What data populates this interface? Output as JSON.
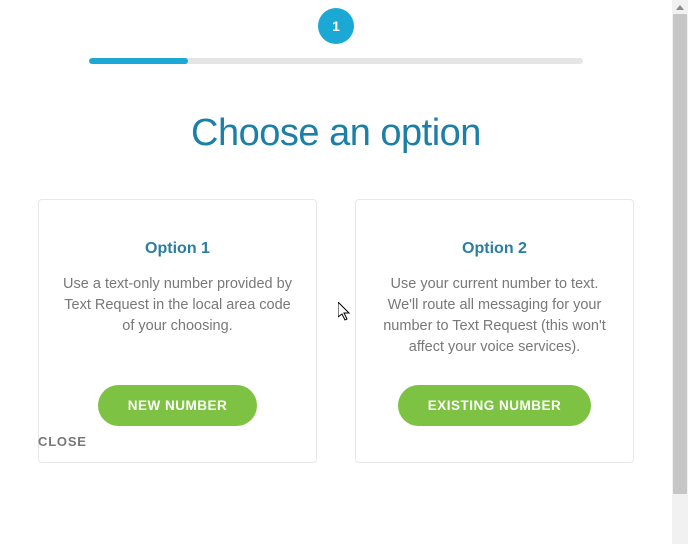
{
  "step": {
    "current_label": "1",
    "progress_percent": 20
  },
  "heading": "Choose an option",
  "options": [
    {
      "title": "Option 1",
      "description": "Use a text-only number provided by Text Request in the local area code of your choosing.",
      "button": "NEW NUMBER"
    },
    {
      "title": "Option 2",
      "description": "Use your current number to text. We'll route all messaging for your number to Text Request (this won't affect your voice services).",
      "button": "EXISTING NUMBER"
    }
  ],
  "close_label": "CLOSE",
  "colors": {
    "accent": "#1BA8D4",
    "heading": "#1B7FA8",
    "button": "#7DC242"
  }
}
